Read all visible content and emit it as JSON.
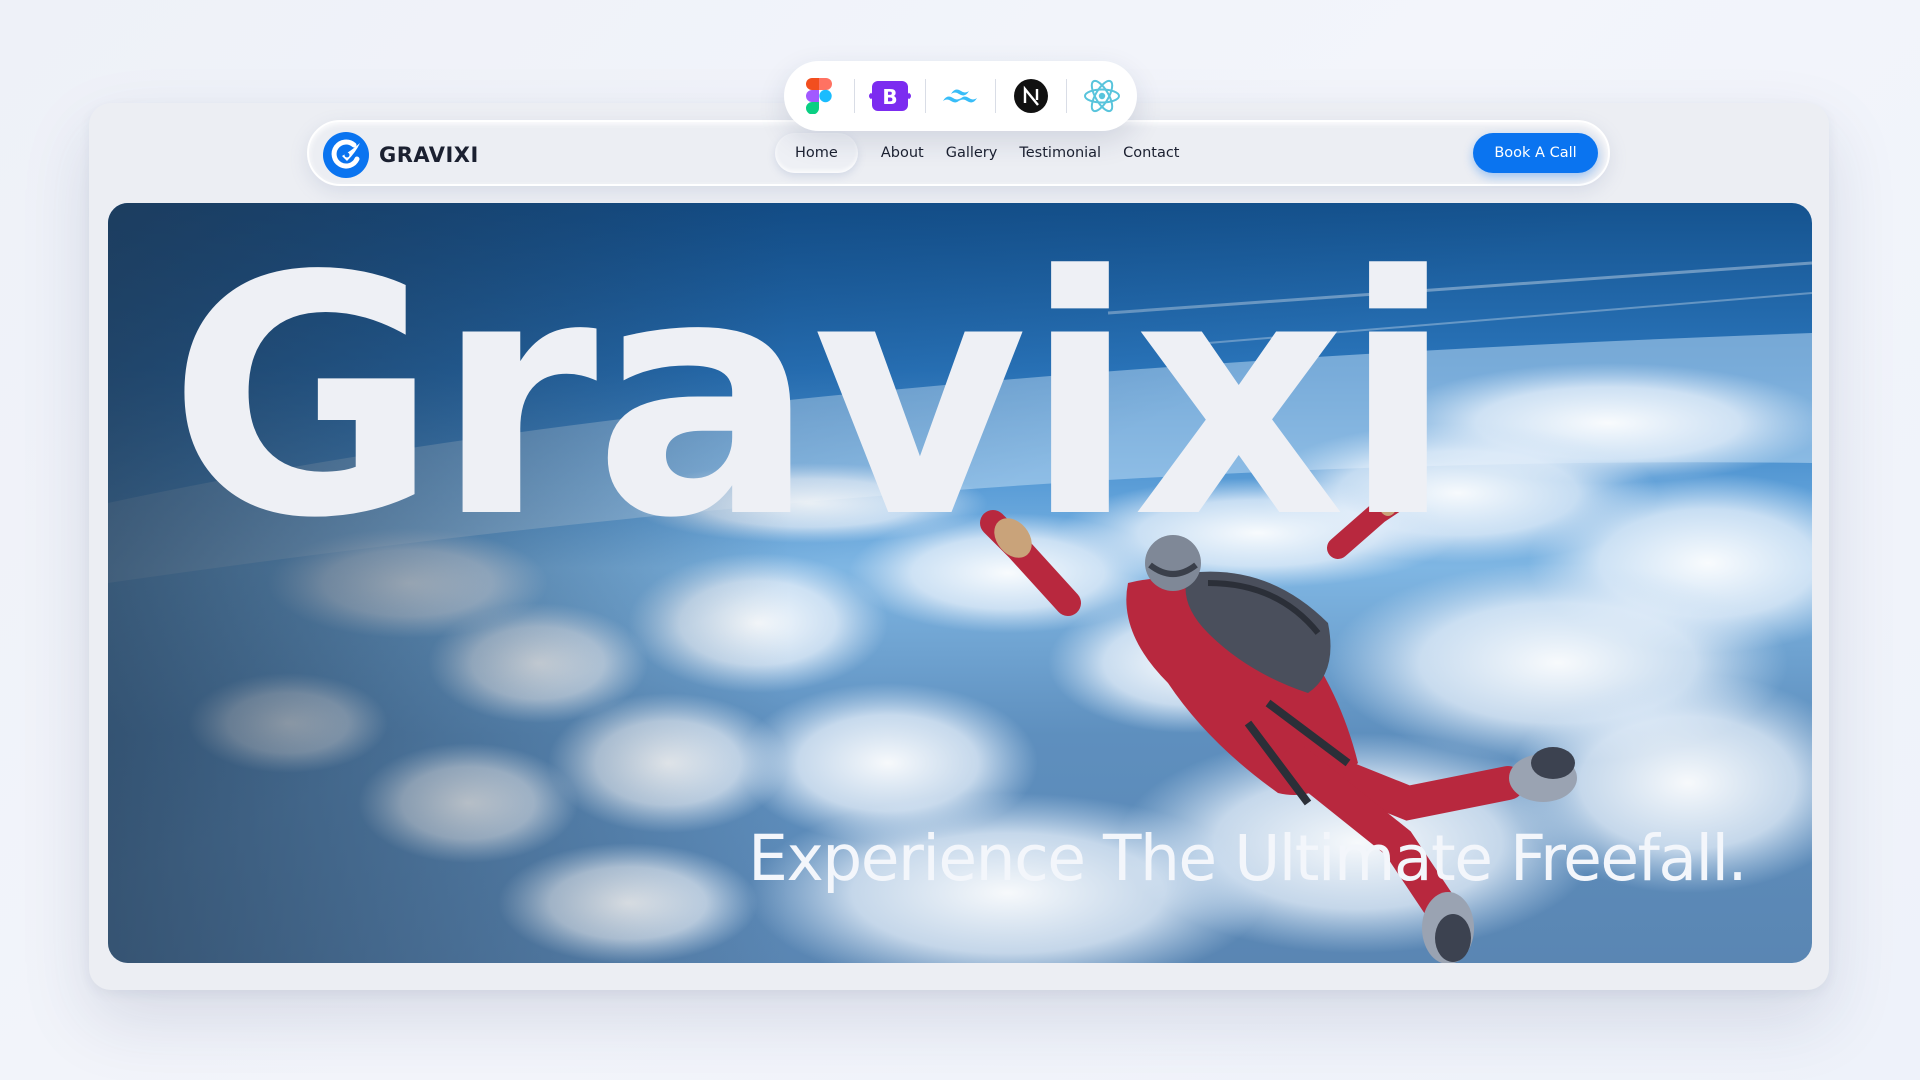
{
  "tech_stack": [
    {
      "icon": "figma-icon",
      "label": "Figma"
    },
    {
      "icon": "bootstrap-icon",
      "label": "Bootstrap"
    },
    {
      "icon": "tailwind-icon",
      "label": "Tailwind"
    },
    {
      "icon": "nextjs-icon",
      "label": "Next.js"
    },
    {
      "icon": "react-icon",
      "label": "React"
    }
  ],
  "brand": {
    "name": "GRAVIXI",
    "logo_icon": "gravixi-logo-icon",
    "accent_color": "#0a74f0"
  },
  "nav": {
    "items": [
      {
        "label": "Home",
        "active": true
      },
      {
        "label": "About",
        "active": false
      },
      {
        "label": "Gallery",
        "active": false
      },
      {
        "label": "Testimonial",
        "active": false
      },
      {
        "label": "Contact",
        "active": false
      }
    ],
    "cta_label": "Book A Call"
  },
  "hero": {
    "title": "Gravixi",
    "tagline": "Experience The Ultimate Freefall."
  }
}
